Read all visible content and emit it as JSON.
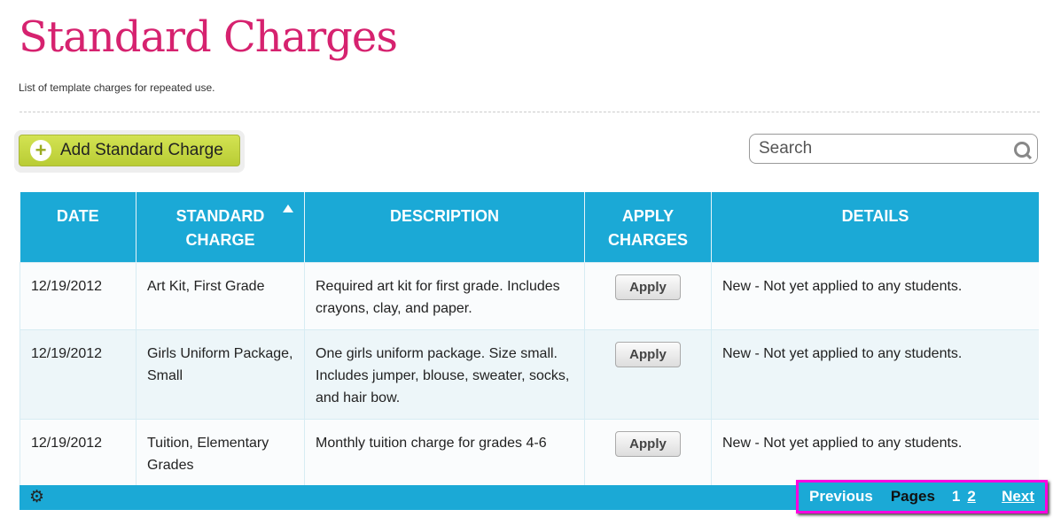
{
  "page": {
    "title": "Standard Charges",
    "subtitle": "List of template charges for repeated use."
  },
  "toolbar": {
    "add_label": "Add Standard Charge",
    "search_placeholder": "Search"
  },
  "table": {
    "headers": [
      "DATE",
      "STANDARD CHARGE",
      "DESCRIPTION",
      "APPLY CHARGES",
      "DETAILS"
    ],
    "sorted_column": "STANDARD CHARGE",
    "sort_direction": "ascending",
    "rows": [
      {
        "date": "12/19/2012",
        "charge": "Art Kit, First Grade",
        "description": "Required art kit for first grade. Includes crayons, clay, and paper.",
        "apply": "Apply",
        "details": "New - Not yet applied to any students."
      },
      {
        "date": "12/19/2012",
        "charge": "Girls Uniform Package, Small",
        "description": "One girls uniform package. Size small. Includes jumper, blouse, sweater, socks, and hair bow.",
        "apply": "Apply",
        "details": "New - Not yet applied to any students."
      },
      {
        "date": "12/19/2012",
        "charge": "Tuition, Elementary Grades",
        "description": "Monthly tuition charge for grades 4-6",
        "apply": "Apply",
        "details": "New - Not yet applied to any students."
      }
    ]
  },
  "pager": {
    "previous": "Previous",
    "pages_label": "Pages",
    "page1": "1",
    "page2": "2",
    "next": "Next",
    "current_page": 1
  },
  "colors": {
    "title": "#d6226f",
    "header": "#1ba9d6",
    "add_button": "#c8da45",
    "highlight": "#ff00e0"
  }
}
